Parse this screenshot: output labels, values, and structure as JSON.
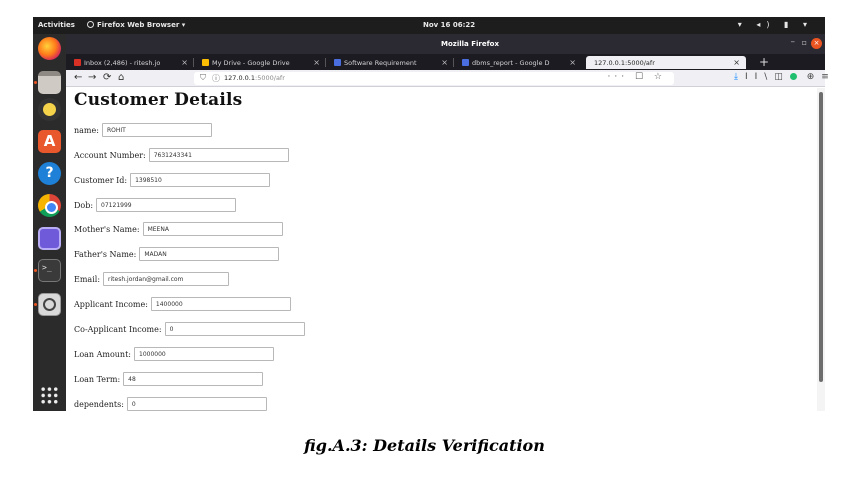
{
  "system_bar": {
    "activities": "Activities",
    "app_name": "Firefox Web Browser ▾",
    "clock": "Nov 16 06:22",
    "tray": "▾ ◂) ▮ ▾"
  },
  "dock": {
    "items": [
      "firefox",
      "files",
      "rhythmbox",
      "ubuntu-software",
      "help",
      "chrome",
      "screenshot",
      "terminal",
      "search-tool",
      "show-applications"
    ]
  },
  "window": {
    "title": "Mozilla Firefox",
    "minimize": "–",
    "maximize": "▫",
    "close": "×"
  },
  "tabs": [
    {
      "label": "Inbox (2,486) - ritesh.jo",
      "color": "#d93025"
    },
    {
      "label": "My Drive - Google Drive",
      "color": "#fbbc04"
    },
    {
      "label": "Software Requirement",
      "color": "#4a6ee0"
    },
    {
      "label": "dbms_report - Google D",
      "color": "#4a6ee0"
    },
    {
      "label": "127.0.0.1:5000/afr",
      "color": ""
    }
  ],
  "new_tab": "+",
  "navbar": {
    "back": "←",
    "forward": "→",
    "reload": "⟳",
    "home": "⌂",
    "url_host": "127.0.0.1",
    "url_path": ":5000/afr",
    "page_actions": "··· ☐ ☆",
    "tools": [
      "⤓",
      "II\\",
      "◫",
      "●",
      "⊕",
      "≡"
    ]
  },
  "page": {
    "title": "Customer Details",
    "fields": [
      {
        "label": "name:",
        "value": "ROHIT"
      },
      {
        "label": "Account Number:",
        "value": "7631243341"
      },
      {
        "label": "Customer Id:",
        "value": "1398510"
      },
      {
        "label": "Dob:",
        "value": "07121999"
      },
      {
        "label": "Mother's Name:",
        "value": "MEENA"
      },
      {
        "label": "Father's Name:",
        "value": "MADAN"
      },
      {
        "label": "Email:",
        "value": "ritesh.jordan@gmail.com"
      },
      {
        "label": "Applicant Income:",
        "value": "1400000"
      },
      {
        "label": "Co-Applicant Income:",
        "value": "0"
      },
      {
        "label": "Loan Amount:",
        "value": "1000000"
      },
      {
        "label": "Loan Term:",
        "value": "48"
      },
      {
        "label": "dependents:",
        "value": "0"
      }
    ]
  },
  "caption": "fig.A.3: Details Verification"
}
